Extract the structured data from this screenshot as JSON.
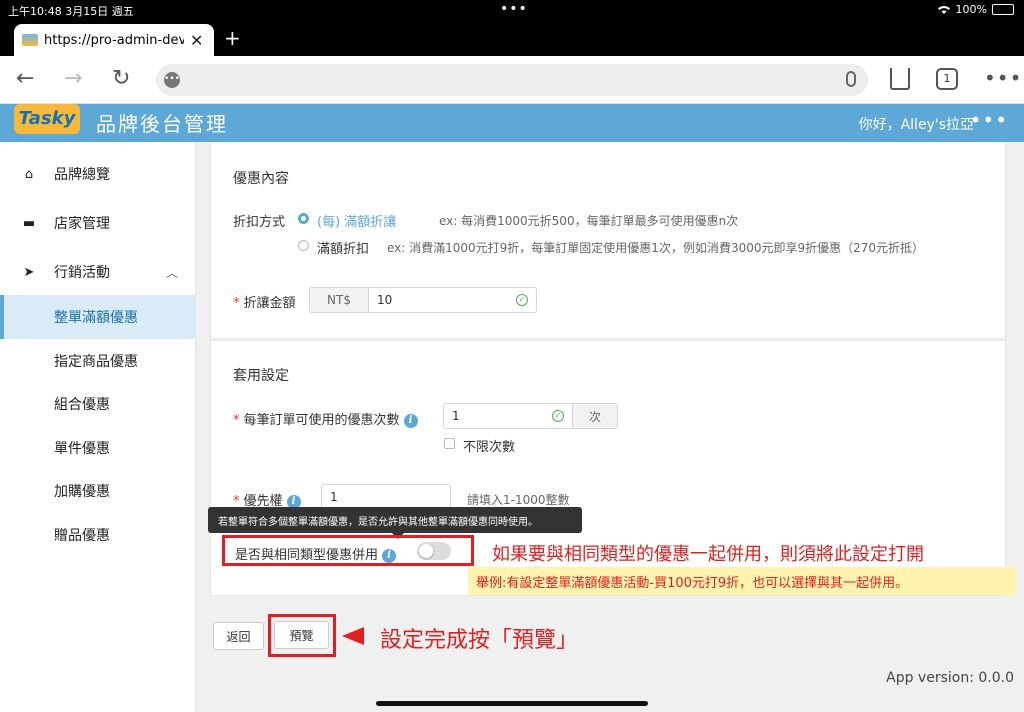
{
  "status": {
    "time": "上午10:48  3月15日 週五",
    "battery": "100%",
    "battery_level": 1.0
  },
  "browser": {
    "tab_title": "https://pro-admin-dev.pc",
    "new_tab": "+",
    "tabs_count": "1"
  },
  "app": {
    "logo_text": "Tasky",
    "title": "品牌後台管理",
    "greeting": "你好，Alley's拉亞"
  },
  "sidebar": {
    "items": [
      {
        "label": "品牌總覽",
        "icon": "home-icon"
      },
      {
        "label": "店家管理",
        "icon": "store-icon"
      },
      {
        "label": "行銷活動",
        "icon": "send-icon"
      }
    ],
    "subitems": [
      {
        "label": "整單滿額優惠",
        "active": true
      },
      {
        "label": "指定商品優惠"
      },
      {
        "label": "組合優惠"
      },
      {
        "label": "單件優惠"
      },
      {
        "label": "加購優惠"
      },
      {
        "label": "贈品優惠"
      }
    ]
  },
  "discount": {
    "section_title": "優惠內容",
    "method_label": "折扣方式",
    "option1_label": "(每) 滿額折讓",
    "option1_hint": "ex: 每消費1000元折500，每筆訂單最多可使用優惠n次",
    "option2_label": "滿額折扣",
    "option2_hint": "ex: 消費滿1000元打9折，每筆訂單固定使用優惠1次，例如消費3000元即享9折優惠（270元折抵）",
    "amount_label": "折讓金額",
    "amount_prefix": "NT$",
    "amount_value": "10"
  },
  "apply": {
    "section_title": "套用設定",
    "times_label": "每筆訂單可使用的優惠次數",
    "times_value": "1",
    "times_suffix": "次",
    "unlimited_label": "不限次數",
    "priority_label": "優先權",
    "priority_value": "1",
    "priority_hint": "請填入1-1000整數",
    "tooltip": "若整單符合多個整單滿額優惠，是否允許與其他整單滿額優惠同時使用。",
    "combine_label": "是否與相同類型優惠併用"
  },
  "annotations": {
    "combine_note": "如果要與相同類型的優惠一起併用，則須將此設定打開",
    "example_note": "舉例:有設定整單滿額優惠活動-買100元打9折，也可以選擇與其一起併用。",
    "preview_note": "設定完成按「預覽」"
  },
  "buttons": {
    "back": "返回",
    "preview": "預覽"
  },
  "footer": {
    "version": "App version: 0.0.0"
  }
}
